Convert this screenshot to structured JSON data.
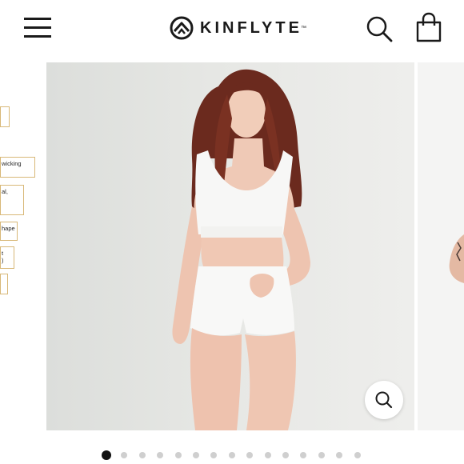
{
  "header": {
    "menu_icon": "hamburger-menu-icon",
    "brand_name": "KINFLYTE",
    "brand_tm": "™",
    "search_icon": "search-icon",
    "cart_icon": "shopping-bag-icon"
  },
  "carousel": {
    "prev_slide_callouts": [
      "",
      "wicking",
      "al,",
      "hape",
      "t\n)",
      ""
    ],
    "zoom_icon": "zoom-magnifier-icon",
    "total_slides": 15,
    "active_slide": 1
  },
  "colors": {
    "text": "#1a1a1a",
    "callout_border": "#d8b878",
    "dot_active": "#111111",
    "dot_inactive": "#cfcfcf"
  }
}
